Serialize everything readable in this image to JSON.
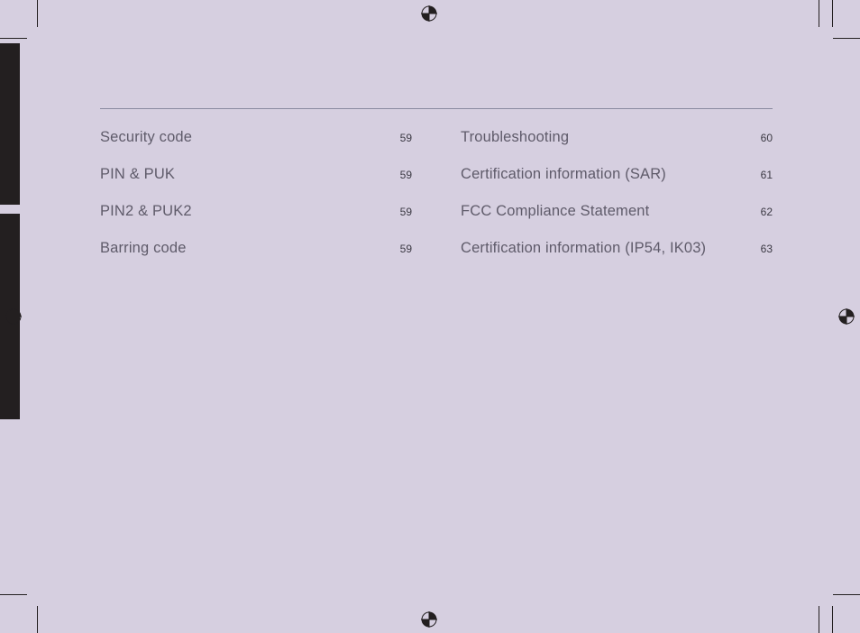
{
  "toc": {
    "left": [
      {
        "label": "Security code",
        "page": "59"
      },
      {
        "label": "PIN & PUK",
        "page": "59"
      },
      {
        "label": "PIN2 & PUK2",
        "page": "59"
      },
      {
        "label": "Barring code",
        "page": "59"
      }
    ],
    "right": [
      {
        "label": "Troubleshooting",
        "page": "60"
      },
      {
        "label": "Certification information (SAR)",
        "page": "61"
      },
      {
        "label": "FCC Compliance Statement",
        "page": "62"
      },
      {
        "label": "Certification information (IP54, IK03)",
        "page": "63"
      }
    ]
  }
}
